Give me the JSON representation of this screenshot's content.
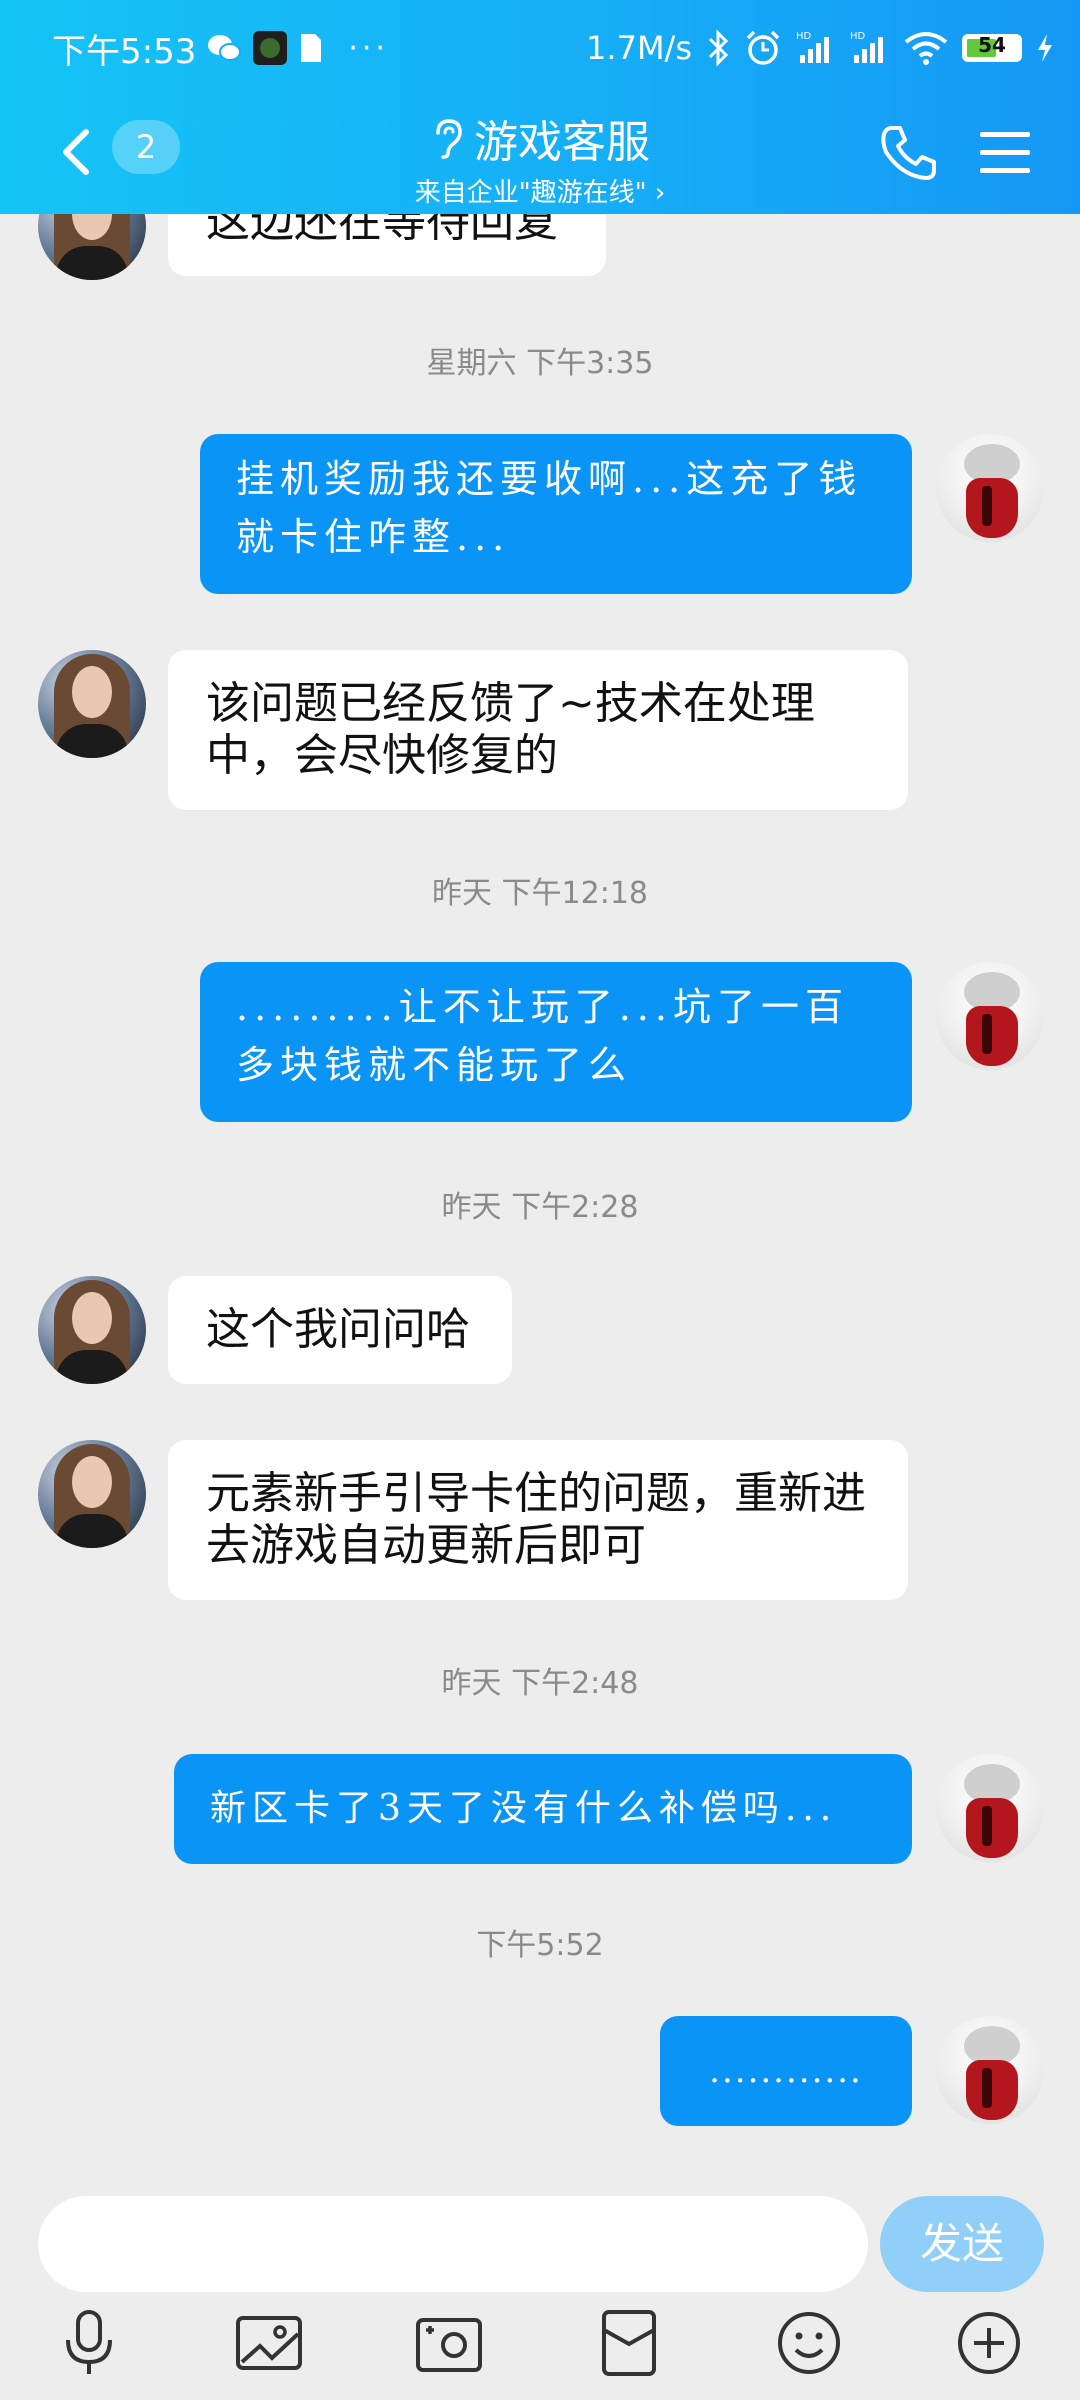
{
  "status_bar": {
    "time": "下午5:53",
    "net_speed": "1.7M/s",
    "battery": "54"
  },
  "header": {
    "unread_count": "2",
    "title": "游戏客服",
    "subtitle": "来自企业\"趣游在线\" ›"
  },
  "messages": [
    {
      "type": "in",
      "text": "这边还在等待回复"
    },
    {
      "type": "time",
      "text": "星期六 下午3:35"
    },
    {
      "type": "out",
      "text": "挂机奖励我还要收啊...这充了钱就卡住咋整..."
    },
    {
      "type": "in",
      "text": "该问题已经反馈了~技术在处理中，会尽快修复的"
    },
    {
      "type": "time",
      "text": "昨天 下午12:18"
    },
    {
      "type": "out",
      "text": ".........让不让玩了...坑了一百多块钱就不能玩了么"
    },
    {
      "type": "time",
      "text": "昨天 下午2:28"
    },
    {
      "type": "in",
      "text": "这个我问问哈"
    },
    {
      "type": "in",
      "text": "元素新手引导卡住的问题，重新进去游戏自动更新后即可"
    },
    {
      "type": "time",
      "text": "昨天 下午2:48"
    },
    {
      "type": "out",
      "text": "新区卡了3天了没有什么补偿吗..."
    },
    {
      "type": "time",
      "text": "下午5:52"
    },
    {
      "type": "out",
      "text": "............"
    }
  ],
  "input": {
    "value": "",
    "send_label": "发送"
  },
  "toolbar": [
    "mic-icon",
    "image-icon",
    "camera-icon",
    "red-packet-icon",
    "emoji-icon",
    "plus-icon"
  ],
  "colors": {
    "header": "#16aef7",
    "out_bubble": "#0a95f6",
    "in_bubble": "#ffffff",
    "background": "#ededed"
  }
}
